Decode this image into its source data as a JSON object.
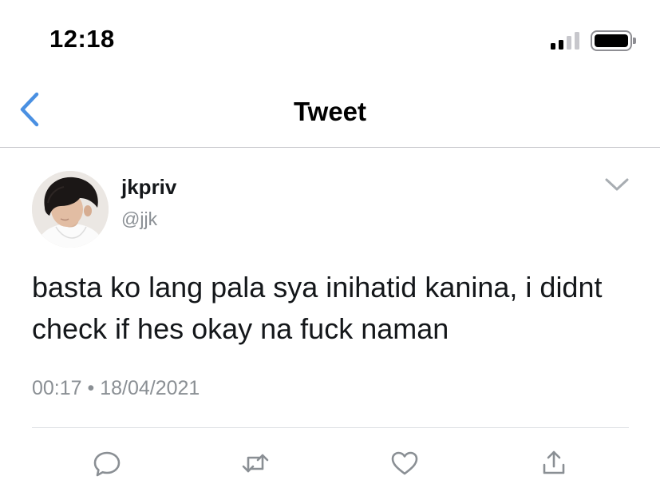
{
  "status_bar": {
    "time": "12:18",
    "signal_icon": "cellular-signal-icon",
    "battery_icon": "battery-icon"
  },
  "nav": {
    "title": "Tweet",
    "back_icon": "chevron-left-icon"
  },
  "tweet": {
    "display_name": "jkpriv",
    "handle": "@jjk",
    "text": "basta ko lang pala sya inihatid kanina, i didnt check if hes okay na fuck naman",
    "timestamp": "00:17 • 18/04/2021"
  },
  "actions": [
    {
      "icon": "reply-icon"
    },
    {
      "icon": "retweet-icon"
    },
    {
      "icon": "like-icon"
    },
    {
      "icon": "share-icon"
    }
  ],
  "colors": {
    "accent": "#4a90e2",
    "icon_gray": "#8a8f94",
    "divider": "#dcdfe2"
  }
}
